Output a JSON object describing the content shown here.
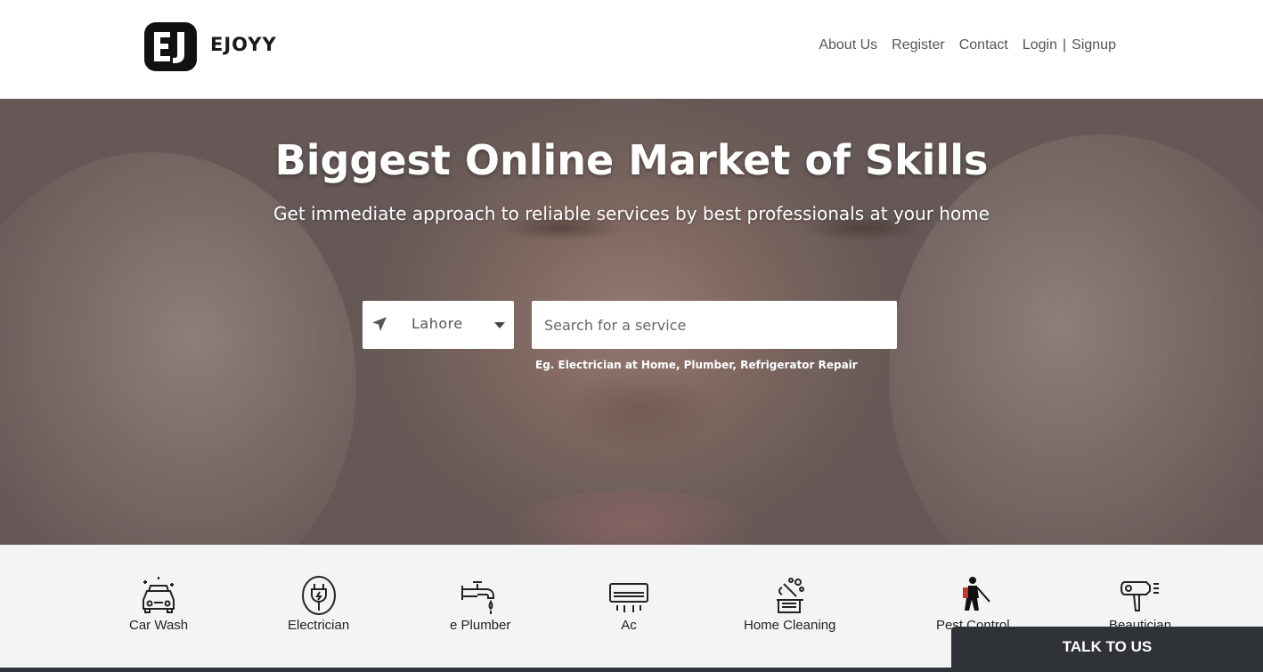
{
  "header": {
    "logo_text": "EJOYY",
    "nav": {
      "about": "About Us",
      "register": "Register",
      "contact": "Contact",
      "login": "Login",
      "separator": "|",
      "signup": "Signup"
    }
  },
  "hero": {
    "title": "Biggest Online Market of Skills",
    "subtitle": "Get immediate approach to reliable services by best professionals at your home",
    "city": {
      "selected": "Lahore"
    },
    "search": {
      "placeholder": "Search for a service",
      "value": ""
    },
    "hint": "Eg. Electrician at Home, Plumber, Refrigerator Repair"
  },
  "categories": [
    {
      "label": "Car Wash",
      "icon": "car-wash-icon"
    },
    {
      "label": "Electrician",
      "icon": "plug-icon"
    },
    {
      "label": "e Plumber",
      "icon": "faucet-icon"
    },
    {
      "label": "Ac",
      "icon": "air-conditioner-icon"
    },
    {
      "label": "Home Cleaning",
      "icon": "cleaning-icon"
    },
    {
      "label": "Pest Control",
      "icon": "pest-control-icon"
    },
    {
      "label": "Beautician",
      "icon": "hair-dryer-icon"
    }
  ],
  "chat": {
    "label": "TALK TO US"
  },
  "colors": {
    "chat_bg": "#2f3237",
    "category_bg": "#f4f4f4",
    "nav_text": "#555555"
  }
}
